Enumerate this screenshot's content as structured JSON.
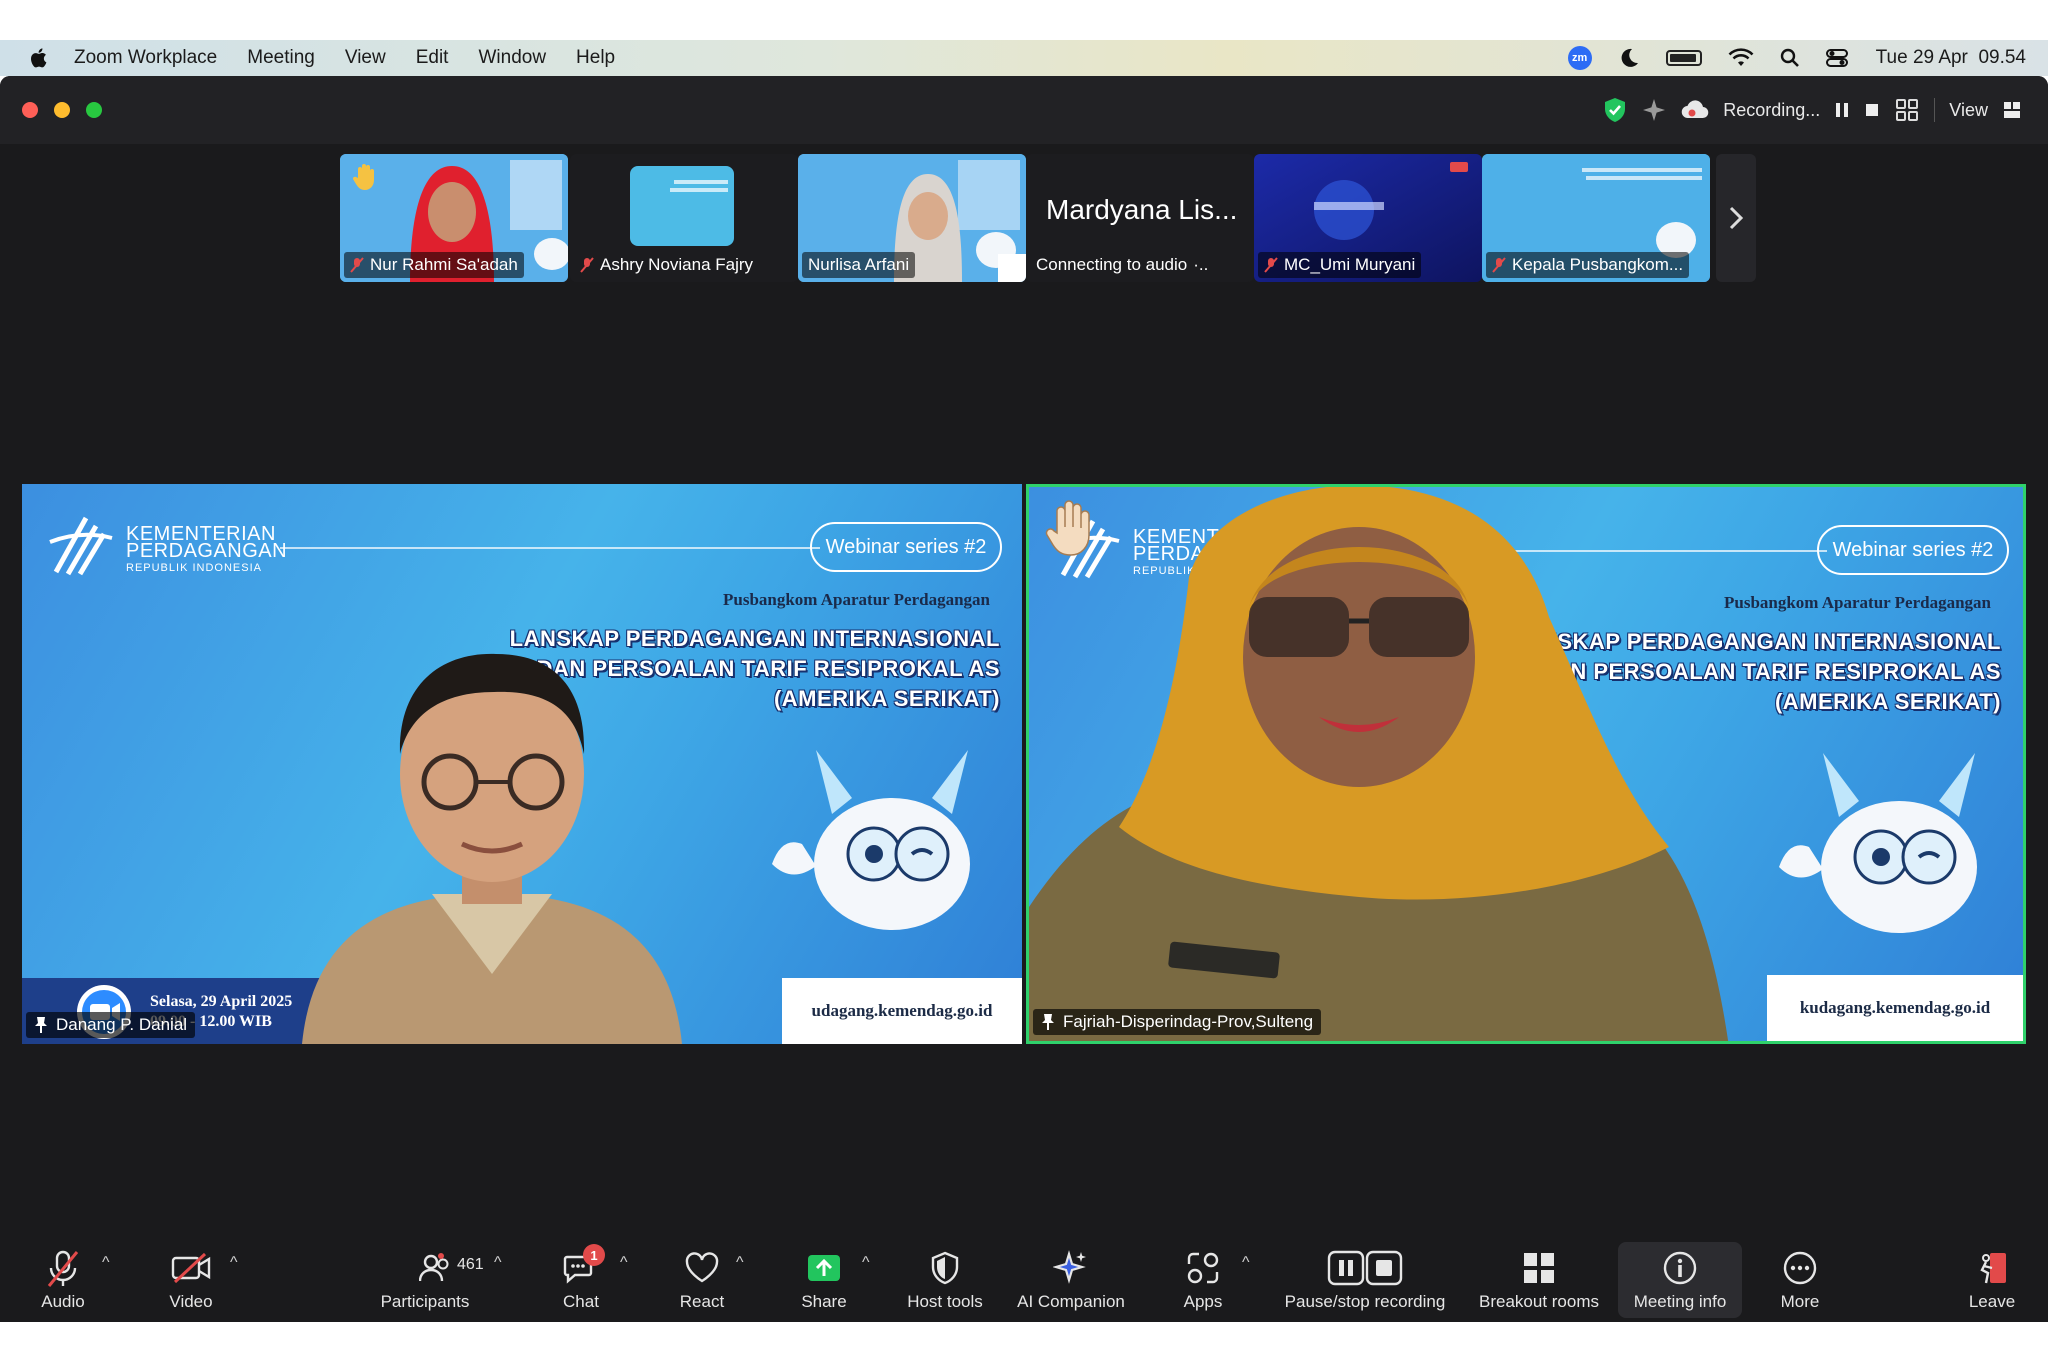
{
  "menubar": {
    "app_name": "Zoom Workplace",
    "items": [
      "Meeting",
      "View",
      "Edit",
      "Window",
      "Help"
    ],
    "zm_badge": "zm",
    "datetime": "Tue 29 Apr  09.54"
  },
  "titlebar": {
    "recording_label": "Recording...",
    "view_label": "View"
  },
  "thumbnails": [
    {
      "name": "Nur Rahmi Sa'adah",
      "muted": true,
      "hand_raised": true
    },
    {
      "name": "Ashry Noviana Fajry",
      "muted": true,
      "hand_raised": false
    },
    {
      "name": "Nurlisa Arfani",
      "muted": false,
      "hand_raised": false
    },
    {
      "name": "Mardyana Lis...",
      "status": "Connecting to audio",
      "muted": false,
      "hand_raised": false
    },
    {
      "name": "MC_Umi Muryani",
      "muted": true,
      "hand_raised": false
    },
    {
      "name": "Kepala Pusbangkom...",
      "muted": true,
      "hand_raised": false
    }
  ],
  "slide": {
    "org_line1": "KEMENTERIAN",
    "org_line2": "PERDAGANGAN",
    "org_line3": "REPUBLIK INDONESIA",
    "series": "Webinar series #2",
    "organizer": "Pusbangkom Aparatur Perdagangan",
    "headline_1": "LANSKAP PERDAGANGAN INTERNASIONAL",
    "headline_2": "DAN PERSOALAN TARIF RESIPROKAL AS",
    "headline_3": "(AMERIKA SERIKAT)",
    "date": "Selasa, 29 April 2025",
    "time": "09.00 - 12.00 WIB",
    "url_left": "udagang.kemendag.go.id",
    "url_right": "kudagang.kemendag.go.id"
  },
  "tiles": [
    {
      "name": "Danang P. Danial",
      "active_speaker": false
    },
    {
      "name": "Fajriah-Disperindag-Prov,Sulteng",
      "active_speaker": true
    }
  ],
  "toolbar": {
    "audio": "Audio",
    "video": "Video",
    "participants": "Participants",
    "participants_count": "461",
    "chat": "Chat",
    "chat_badge": "1",
    "react": "React",
    "share": "Share",
    "host_tools": "Host tools",
    "ai_companion": "AI Companion",
    "apps": "Apps",
    "pause_stop_recording": "Pause/stop recording",
    "breakout_rooms": "Breakout rooms",
    "meeting_info": "Meeting info",
    "more": "More",
    "leave": "Leave"
  },
  "colors": {
    "window_bg": "#1a1a1c",
    "active_speaker_border": "#2fd16b",
    "slide_blue": "#3ea7e6",
    "share_green": "#22c55e",
    "leave_red": "#e24a4a",
    "recording_dot": "#e24a4a"
  }
}
